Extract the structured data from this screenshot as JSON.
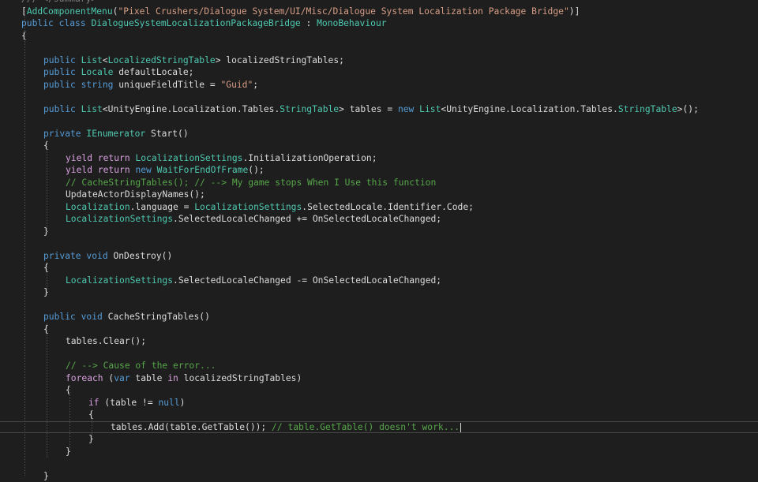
{
  "editor": {
    "lines": [
      [
        [
          "cm-lead",
          "/// </summary>"
        ]
      ],
      [
        [
          "pl",
          "["
        ],
        [
          "ty",
          "AddComponentMenu"
        ],
        [
          "pl",
          "("
        ],
        [
          "st",
          "\"Pixel Crushers/Dialogue System/UI/Misc/Dialogue System Localization Package Bridge\""
        ],
        [
          "pl",
          ")]"
        ]
      ],
      [
        [
          "kw",
          "public"
        ],
        [
          "pl",
          " "
        ],
        [
          "kw",
          "class"
        ],
        [
          "pl",
          " "
        ],
        [
          "ty",
          "DialogueSystemLocalizationPackageBridge"
        ],
        [
          "pl",
          " : "
        ],
        [
          "ty",
          "MonoBehaviour"
        ]
      ],
      [
        [
          "pl",
          "{"
        ]
      ],
      [],
      [
        [
          "kw",
          "public"
        ],
        [
          "pl",
          " "
        ],
        [
          "ty",
          "List"
        ],
        [
          "pl",
          "<"
        ],
        [
          "ty",
          "LocalizedStringTable"
        ],
        [
          "pl",
          "> localizedStringTables;"
        ]
      ],
      [
        [
          "kw",
          "public"
        ],
        [
          "pl",
          " "
        ],
        [
          "ty",
          "Locale"
        ],
        [
          "pl",
          " defaultLocale;"
        ]
      ],
      [
        [
          "kw",
          "public"
        ],
        [
          "pl",
          " "
        ],
        [
          "kw",
          "string"
        ],
        [
          "pl",
          " uniqueFieldTitle = "
        ],
        [
          "st",
          "\"Guid\""
        ],
        [
          "pl",
          ";"
        ]
      ],
      [],
      [
        [
          "kw",
          "public"
        ],
        [
          "pl",
          " "
        ],
        [
          "ty",
          "List"
        ],
        [
          "pl",
          "<UnityEngine.Localization.Tables."
        ],
        [
          "ty",
          "StringTable"
        ],
        [
          "pl",
          "> tables = "
        ],
        [
          "kw",
          "new"
        ],
        [
          "pl",
          " "
        ],
        [
          "ty",
          "List"
        ],
        [
          "pl",
          "<UnityEngine.Localization.Tables."
        ],
        [
          "ty",
          "StringTable"
        ],
        [
          "pl",
          ">();"
        ]
      ],
      [],
      [
        [
          "kw",
          "private"
        ],
        [
          "pl",
          " "
        ],
        [
          "ty",
          "IEnumerator"
        ],
        [
          "pl",
          " Start()"
        ]
      ],
      [
        [
          "pl",
          "{"
        ]
      ],
      [
        [
          "kc",
          "yield"
        ],
        [
          "pl",
          " "
        ],
        [
          "kc",
          "return"
        ],
        [
          "pl",
          " "
        ],
        [
          "ty",
          "LocalizationSettings"
        ],
        [
          "pl",
          ".InitializationOperation;"
        ]
      ],
      [
        [
          "kc",
          "yield"
        ],
        [
          "pl",
          " "
        ],
        [
          "kc",
          "return"
        ],
        [
          "pl",
          " "
        ],
        [
          "kw",
          "new"
        ],
        [
          "pl",
          " "
        ],
        [
          "ty",
          "WaitForEndOfFrame"
        ],
        [
          "pl",
          "();"
        ]
      ],
      [
        [
          "cm",
          "// CacheStringTables(); // --> My game stops When I Use this function"
        ]
      ],
      [
        [
          "pl",
          "UpdateActorDisplayNames();"
        ]
      ],
      [
        [
          "ty",
          "Localization"
        ],
        [
          "pl",
          ".language = "
        ],
        [
          "ty",
          "LocalizationSettings"
        ],
        [
          "pl",
          ".SelectedLocale.Identifier.Code;"
        ]
      ],
      [
        [
          "ty",
          "LocalizationSettings"
        ],
        [
          "pl",
          ".SelectedLocaleChanged += OnSelectedLocaleChanged;"
        ]
      ],
      [
        [
          "pl",
          "}"
        ]
      ],
      [],
      [
        [
          "kw",
          "private"
        ],
        [
          "pl",
          " "
        ],
        [
          "kw",
          "void"
        ],
        [
          "pl",
          " OnDestroy()"
        ]
      ],
      [
        [
          "pl",
          "{"
        ]
      ],
      [
        [
          "ty",
          "LocalizationSettings"
        ],
        [
          "pl",
          ".SelectedLocaleChanged -= OnSelectedLocaleChanged;"
        ]
      ],
      [
        [
          "pl",
          "}"
        ]
      ],
      [],
      [
        [
          "kw",
          "public"
        ],
        [
          "pl",
          " "
        ],
        [
          "kw",
          "void"
        ],
        [
          "pl",
          " CacheStringTables()"
        ]
      ],
      [
        [
          "pl",
          "{"
        ]
      ],
      [
        [
          "pl",
          "tables.Clear();"
        ]
      ],
      [],
      [
        [
          "cm",
          "// --> Cause of the error..."
        ]
      ],
      [
        [
          "kc",
          "foreach"
        ],
        [
          "pl",
          " ("
        ],
        [
          "kw",
          "var"
        ],
        [
          "pl",
          " table "
        ],
        [
          "kc",
          "in"
        ],
        [
          "pl",
          " localizedStringTables)"
        ]
      ],
      [
        [
          "pl",
          "{"
        ]
      ],
      [
        [
          "kc",
          "if"
        ],
        [
          "pl",
          " (table != "
        ],
        [
          "kw",
          "null"
        ],
        [
          "pl",
          ")"
        ]
      ],
      [
        [
          "pl",
          "{"
        ]
      ],
      [
        [
          "pl",
          "tables.Add(table.GetTable()); "
        ],
        [
          "cm",
          "// table.GetTable() doesn't work..."
        ]
      ],
      [
        [
          "pl",
          "}"
        ]
      ],
      [
        [
          "pl",
          "}"
        ]
      ],
      [],
      [
        [
          "pl",
          "}"
        ]
      ]
    ]
  }
}
